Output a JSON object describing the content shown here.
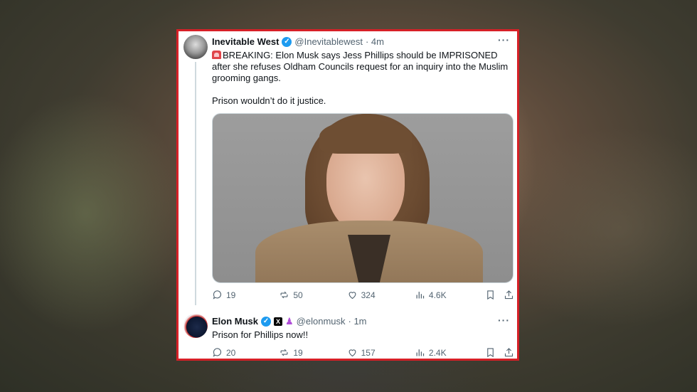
{
  "tweet1": {
    "name": "Inevitable West",
    "handle": "@Inevitablewest",
    "time": "· 4m",
    "text_line1": "BREAKING: Elon Musk says Jess Phillips should be IMPRISONED after she refuses Oldham Councils request for an inquiry into the Muslim grooming gangs.",
    "text_line2": "Prison wouldn’t do it justice.",
    "replies": "19",
    "reposts": "50",
    "likes": "324",
    "views": "4.6K"
  },
  "tweet2": {
    "name": "Elon Musk",
    "handle": "@elonmusk",
    "time": "· 1m",
    "text": "Prison for Phillips now!!",
    "replies": "20",
    "reposts": "19",
    "likes": "157",
    "views": "2.4K"
  },
  "colors": {
    "border": "#d62027",
    "verified": "#1d9bf0",
    "text": "#0f1419",
    "muted": "#536471"
  },
  "icons": [
    "siren-icon",
    "verified-icon",
    "x-logo-icon",
    "person-badge-icon",
    "more-icon",
    "reply-icon",
    "repost-icon",
    "like-icon",
    "views-icon",
    "bookmark-icon",
    "share-icon"
  ]
}
